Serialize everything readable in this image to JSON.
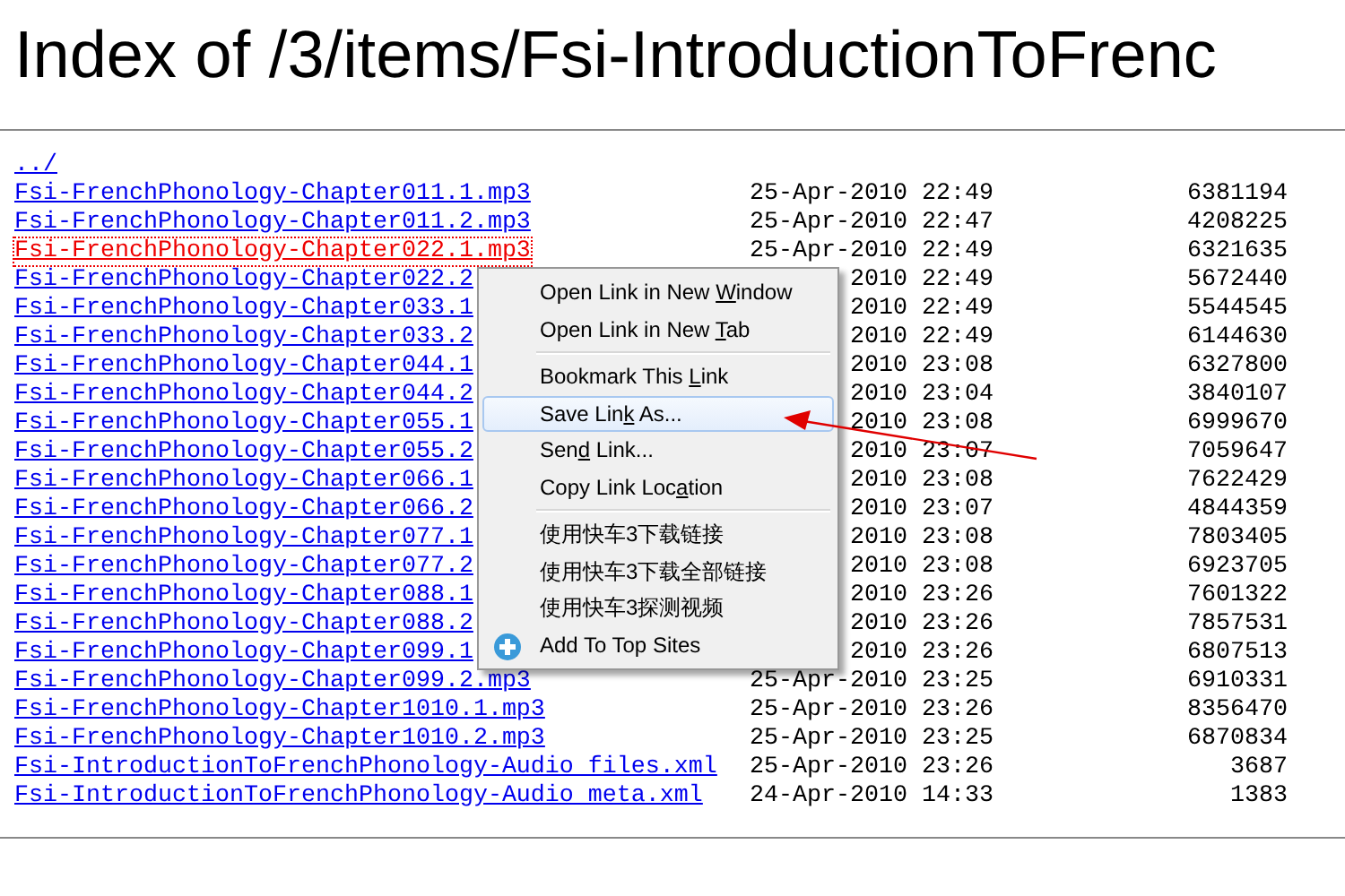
{
  "heading": "Index of /3/items/Fsi-IntroductionToFrenc",
  "listing": [
    {
      "name": "../",
      "focused": false
    },
    {
      "name": "Fsi-FrenchPhonology-Chapter011.1.mp3",
      "date": "25-Apr-2010 22:49",
      "size": "6381194",
      "focused": false
    },
    {
      "name": "Fsi-FrenchPhonology-Chapter011.2.mp3",
      "date": "25-Apr-2010 22:47",
      "size": "4208225",
      "focused": false
    },
    {
      "name": "Fsi-FrenchPhonology-Chapter022.1.mp3",
      "date": "25-Apr-2010 22:49",
      "size": "6321635",
      "focused": true
    },
    {
      "name": "Fsi-FrenchPhonology-Chapter022.2",
      "date": "2010 22:49",
      "size": "5672440",
      "focused": false
    },
    {
      "name": "Fsi-FrenchPhonology-Chapter033.1",
      "date": "2010 22:49",
      "size": "5544545",
      "focused": false
    },
    {
      "name": "Fsi-FrenchPhonology-Chapter033.2",
      "date": "2010 22:49",
      "size": "6144630",
      "focused": false
    },
    {
      "name": "Fsi-FrenchPhonology-Chapter044.1",
      "date": "2010 23:08",
      "size": "6327800",
      "focused": false
    },
    {
      "name": "Fsi-FrenchPhonology-Chapter044.2",
      "date": "2010 23:04",
      "size": "3840107",
      "focused": false
    },
    {
      "name": "Fsi-FrenchPhonology-Chapter055.1",
      "date": "2010 23:08",
      "size": "6999670",
      "focused": false
    },
    {
      "name": "Fsi-FrenchPhonology-Chapter055.2",
      "date": "2010 23:07",
      "size": "7059647",
      "focused": false
    },
    {
      "name": "Fsi-FrenchPhonology-Chapter066.1",
      "date": "2010 23:08",
      "size": "7622429",
      "focused": false
    },
    {
      "name": "Fsi-FrenchPhonology-Chapter066.2",
      "date": "2010 23:07",
      "size": "4844359",
      "focused": false
    },
    {
      "name": "Fsi-FrenchPhonology-Chapter077.1",
      "date": "2010 23:08",
      "size": "7803405",
      "focused": false
    },
    {
      "name": "Fsi-FrenchPhonology-Chapter077.2",
      "date": "2010 23:08",
      "size": "6923705",
      "focused": false
    },
    {
      "name": "Fsi-FrenchPhonology-Chapter088.1",
      "date": "2010 23:26",
      "size": "7601322",
      "focused": false
    },
    {
      "name": "Fsi-FrenchPhonology-Chapter088.2",
      "date": "2010 23:26",
      "size": "7857531",
      "focused": false
    },
    {
      "name": "Fsi-FrenchPhonology-Chapter099.1",
      "date": "2010 23:26",
      "size": "6807513",
      "focused": false
    },
    {
      "name": "Fsi-FrenchPhonology-Chapter099.2.mp3",
      "date": "25-Apr-2010 23:25",
      "size": "6910331",
      "focused": false
    },
    {
      "name": "Fsi-FrenchPhonology-Chapter1010.1.mp3",
      "date": "25-Apr-2010 23:26",
      "size": "8356470",
      "focused": false
    },
    {
      "name": "Fsi-FrenchPhonology-Chapter1010.2.mp3",
      "date": "25-Apr-2010 23:25",
      "size": "6870834",
      "focused": false
    },
    {
      "name": "Fsi-IntroductionToFrenchPhonology-Audio files.xml",
      "date": "25-Apr-2010 23:26",
      "size": "3687",
      "focused": false
    },
    {
      "name": "Fsi-IntroductionToFrenchPhonology-Audio meta.xml",
      "date": "24-Apr-2010 14:33",
      "size": "1383",
      "focused": false
    }
  ],
  "context_menu": [
    {
      "kind": "item",
      "label_before": "Open Link in New ",
      "access_key": "W",
      "label_after": "indow",
      "selected": false
    },
    {
      "kind": "item",
      "label_before": "Open Link in New ",
      "access_key": "T",
      "label_after": "ab",
      "selected": false
    },
    {
      "kind": "separator"
    },
    {
      "kind": "item",
      "label_before": "Bookmark This ",
      "access_key": "L",
      "label_after": "ink",
      "selected": false
    },
    {
      "kind": "item",
      "label_before": "Save Lin",
      "access_key": "k",
      "label_after": " As...",
      "selected": true
    },
    {
      "kind": "item",
      "label_before": "Sen",
      "access_key": "d",
      "label_after": " Link...",
      "selected": false
    },
    {
      "kind": "item",
      "label_before": "Copy Link Loc",
      "access_key": "a",
      "label_after": "tion",
      "selected": false
    },
    {
      "kind": "separator"
    },
    {
      "kind": "item",
      "label": "使用快车3下载链接",
      "selected": false
    },
    {
      "kind": "item",
      "label": "使用快车3下载全部链接",
      "selected": false
    },
    {
      "kind": "item",
      "label": "使用快车3探测视频",
      "selected": false
    },
    {
      "kind": "icon-item",
      "label": "Add To Top Sites",
      "selected": false
    }
  ]
}
